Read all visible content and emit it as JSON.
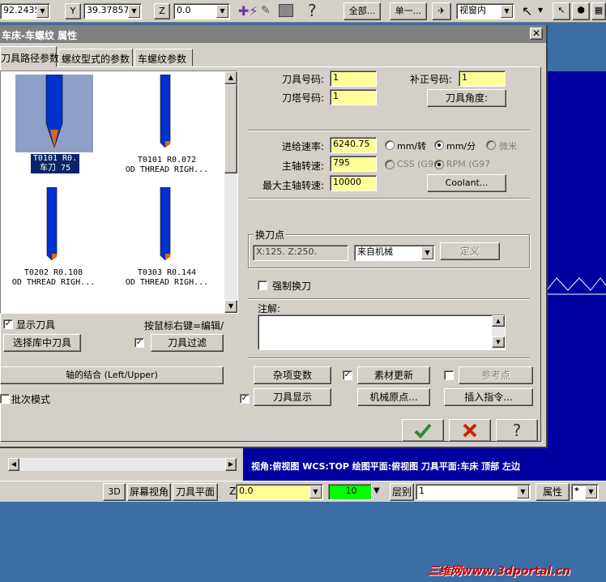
{
  "toolbar": {
    "x_value": "92.2435",
    "y_label": "Y",
    "y_value": "39.37857",
    "z_label": "Z",
    "z_value": "0.0",
    "all_label": "全部...",
    "single_label": "单一...",
    "view_select": "视窗内"
  },
  "dialog": {
    "title": "车床-车螺纹 属性",
    "tabs": [
      "刀具路径参数",
      "螺纹型式的参数",
      "车螺纹参数"
    ],
    "tools": [
      {
        "line1": "T0101 R0.",
        "line2": "车刀 75"
      },
      {
        "line1": "T0101 R0.072",
        "line2": "OD THREAD RIGH..."
      },
      {
        "line1": "T0202 R0.108",
        "line2": "OD THREAD RIGH..."
      },
      {
        "line1": "T0303 R0.144",
        "line2": "OD THREAD RIGH..."
      }
    ],
    "show_tool_label": "显示刀具",
    "right_click_hint": "按鼠标右键=编辑/",
    "select_lib_tool": "选择库中刀具",
    "tool_filter": "刀具过滤",
    "tool_number_label": "刀具号码:",
    "tool_number": "1",
    "offset_number_label": "补正号码:",
    "offset_number": "1",
    "turret_number_label": "刀塔号码:",
    "turret_number": "1",
    "tool_angle_button": "刀具角度:",
    "feed_rate_label": "进给速率:",
    "feed_rate": "6240.75",
    "mm_per_rev": "mm/转",
    "mm_per_min": "mm/分",
    "micro": "微米",
    "spindle_speed_label": "主轴转速:",
    "spindle_speed": "795",
    "css_label": "CSS (G96",
    "rpm_label": "RPM (G97",
    "max_spindle_label": "最大主轴转速:",
    "max_spindle": "10000",
    "coolant_button": "Coolant...",
    "tool_change_group": "换刀点",
    "tool_change_coords": "X:125.   Z:250.",
    "tool_change_source": "来自机械",
    "define_button": "定义",
    "force_tool_change": "强制换刀",
    "comment_label": "注解:",
    "axis_combo_button": "轴的结合 (Left/Upper)",
    "misc_values_button": "杂项变数",
    "stock_update_button": "素材更新",
    "ref_point_button": "参考点",
    "batch_mode": "批次模式",
    "tool_display_button": "刀具显示",
    "machine_origin_button": "机械原点...",
    "insert_cmd_button": "插入指令..."
  },
  "viewport": {
    "status_text": "视角:俯视图   WCS:TOP   绘图平面:俯视图   刀具平面:车床 顶部 左边"
  },
  "statusbar": {
    "btn_3d": "3D",
    "screen_view": "屏幕视角",
    "tool_plane": "刀具平面",
    "z_label": "Z",
    "z_value": "0.0",
    "color_value": "10",
    "level_label": "层别",
    "level_value": "1",
    "attributes": "属性",
    "star": "*"
  },
  "watermark": "三维网www.3dportal.cn",
  "colors": {
    "tool_blue": "#0033cc",
    "tool_tip": "#d2691e",
    "input_yellow": "#ffff99",
    "ok_green": "#2e8b2e",
    "cancel_red": "#cc2200",
    "viewport_blue": "#0000a0",
    "desktop_blue": "#3a6ea5"
  }
}
